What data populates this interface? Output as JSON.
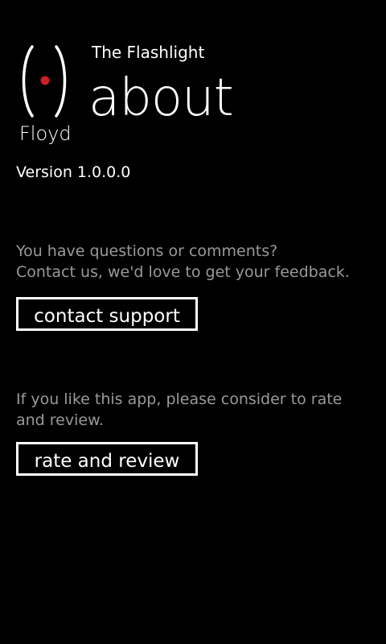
{
  "header": {
    "app_title": "The Flashlight",
    "page_title": "about",
    "logo_text": "Floyd"
  },
  "version": {
    "label": "Version 1.0.0.0"
  },
  "contact": {
    "description_lines": [
      "You have questions or comments?",
      "Contact us, we'd love to get your feedback."
    ],
    "button_label": "contact support"
  },
  "rate": {
    "description_lines": [
      "If you like this app, please consider to rate",
      "and review."
    ],
    "button_label": "rate and review"
  },
  "colors": {
    "background": "#000000",
    "text": "#ffffff",
    "subtle_text": "#999999",
    "accent_dot": "#cc1f2a"
  }
}
